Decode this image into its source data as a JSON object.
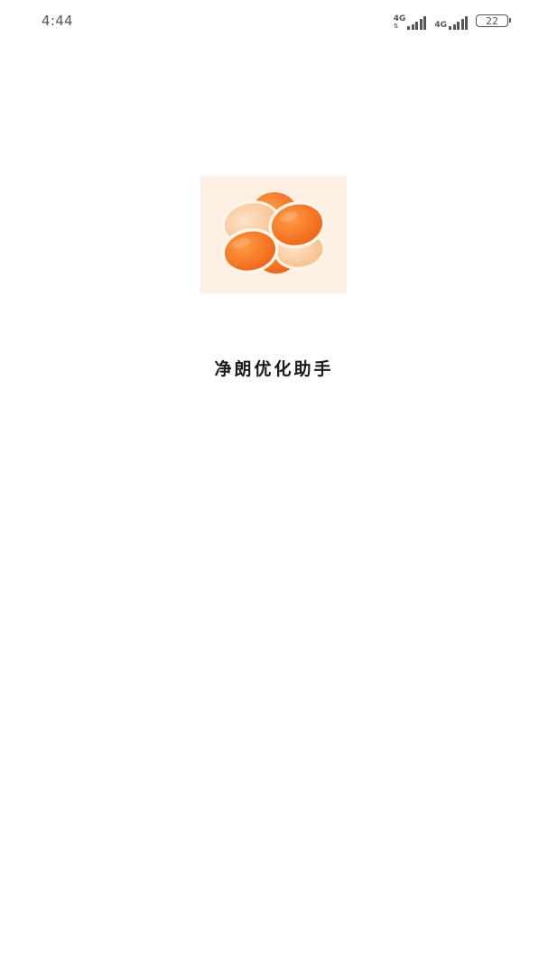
{
  "status_bar": {
    "time": "4:44",
    "signal_1": {
      "network": "4G",
      "strength": 4
    },
    "signal_2": {
      "network": "4G",
      "strength": 4
    },
    "battery": {
      "level": "22"
    }
  },
  "splash": {
    "logo_icon": "orange-blossom-logo-icon",
    "app_name": "净朗优化助手"
  },
  "colors": {
    "logo_background": "#fdf0e2",
    "logo_orange": "#f36f1e",
    "logo_light_orange": "#f9c79a",
    "status_text": "#555555"
  }
}
